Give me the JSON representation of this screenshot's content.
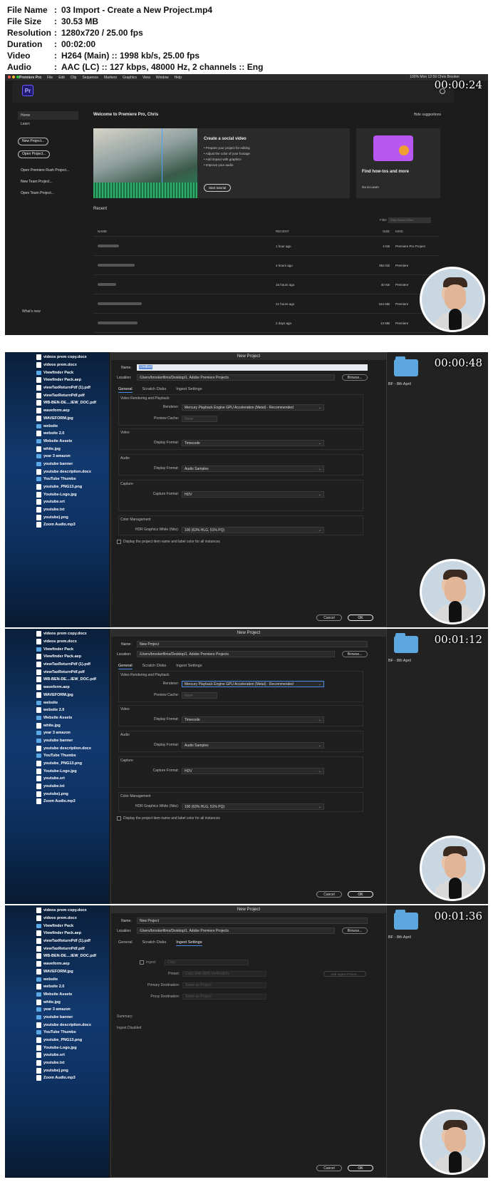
{
  "info": [
    {
      "key": "File Name",
      "sep": ":",
      "value": "03 Import - Create a New Project.mp4"
    },
    {
      "key": "File Size",
      "sep": ":",
      "value": "30.53 MB"
    },
    {
      "key": "Resolution",
      "sep": ":",
      "value": "1280x720 / 25.00 fps"
    },
    {
      "key": "Duration",
      "sep": ":",
      "value": "00:02:00"
    },
    {
      "key": "Video",
      "sep": ":",
      "value": "H264 (Main) :: 1998 kb/s, 25.00 fps"
    },
    {
      "key": "Audio",
      "sep": ":",
      "value": "AAC (LC) :: 127 kbps, 48000 Hz, 2 channels :: Eng"
    }
  ],
  "timecodes": [
    "00:00:24",
    "00:00:48",
    "00:01:12",
    "00:01:36"
  ],
  "home": {
    "menubar": [
      "Premiere Pro",
      "File",
      "Edit",
      "Clip",
      "Sequence",
      "Markers",
      "Graphics",
      "View",
      "Window",
      "Help"
    ],
    "menubar_right": "100%  Mon 12:59  Chris Brooker",
    "logo": "Pr",
    "nav": {
      "home": "Home",
      "learn": "Learn",
      "new_project": "New Project...",
      "open_project": "Open Project...",
      "open_rush": "Open Premiere Rush Project...",
      "new_team": "New Team Project...",
      "open_team": "Open Team Project...",
      "whats_new": "What's new"
    },
    "welcome": "Welcome to Premiere Pro, Chris",
    "hide_suggestions": "Hide suggestions",
    "social": {
      "title": "Create a social video",
      "items": [
        "Prepare your project for editing",
        "Adjust the color of your footage",
        "Add impact with graphics",
        "Improve your audio"
      ],
      "button": "Start tutorial"
    },
    "howto": {
      "title": "Find how-tos and more",
      "link": "Go to Learn"
    },
    "recent_title": "Recent",
    "filter_label": "Filter",
    "filter_placeholder": "Filter Recent Files",
    "table_headers": {
      "name": "NAME",
      "recent": "RECENT",
      "size": "SIZE",
      "kind": "KIND"
    },
    "rows": [
      {
        "recent": "1 hour ago",
        "size": "4 KB",
        "kind": "Premiere Pro Project"
      },
      {
        "recent": "4 hours ago",
        "size": "952 KB",
        "kind": "Premiere"
      },
      {
        "recent": "15 hours ago",
        "size": "40 KB",
        "kind": "Premiere"
      },
      {
        "recent": "21 hours ago",
        "size": "164 MB",
        "kind": "Premiere"
      },
      {
        "recent": "2 days ago",
        "size": "13 MB",
        "kind": "Premiere"
      }
    ]
  },
  "finder_items": [
    "videos prem copy.docx",
    "videos prem.docx",
    "Viewfinder Pack",
    "Viewfinder Pack.aep",
    "viewTaxReturnPdf (1).pdf",
    "viewTaxReturnPdf.pdf",
    "WB-BEN-DE....IEW_DOC.pdf",
    "waveform.aep",
    "WAVEFORM.jpg",
    "website",
    "website 2.0",
    "Website Assets",
    "white.jpg",
    "year 3 amazon",
    "youtube banner",
    "youtube description.docx",
    "YouTube Thumbs",
    "youtube_PNG13.png",
    "Youtube-Logo.jpg",
    "youtube.srt",
    "youtube.txt",
    "youtube).png",
    "Zoom Audio.mp3"
  ],
  "desktop_label": "BF - 8th April",
  "dialog": {
    "title": "New Project",
    "name_label": "Name:",
    "name_untitled": "Untitled",
    "name_value": "New Project",
    "location_label": "Location:",
    "location_value": "/Users/brookerfilms/Desktop/1. Adobe Premiere Projects",
    "browse": "Browse...",
    "tabs": [
      "General",
      "Scratch Disks",
      "Ingest Settings"
    ],
    "vr_title": "Video Rendering and Playback",
    "renderer_label": "Renderer:",
    "renderer_value": "Mercury Playback Engine GPU Acceleration (Metal) - Recommended",
    "preview_label": "Preview Cache:",
    "preview_value": "None",
    "video_title": "Video",
    "display_format_label": "Display Format:",
    "video_format": "Timecode",
    "audio_title": "Audio",
    "audio_format": "Audio Samples",
    "capture_title": "Capture",
    "capture_label": "Capture Format:",
    "capture_value": "HDV",
    "color_title": "Color Management",
    "hdr_label": "HDR Graphics White (Nits):",
    "hdr_value": "100 (63% HLG, 51% PQ)",
    "checkbox_label": "Display the project item name and label color for all instances",
    "cancel": "Cancel",
    "ok": "OK",
    "ingest": {
      "label": "Ingest",
      "copy": "Copy",
      "preset_label": "Preset:",
      "preset_value": "Copy With MD5 Verification",
      "add_preset": "Add Ingest Preset...",
      "primary_label": "Primary Destination:",
      "primary_value": "Same as Project",
      "proxy_label": "Proxy Destination:",
      "proxy_value": "Same as Project",
      "summary_label": "Summary:",
      "summary_value": "Ingest Disabled"
    }
  }
}
